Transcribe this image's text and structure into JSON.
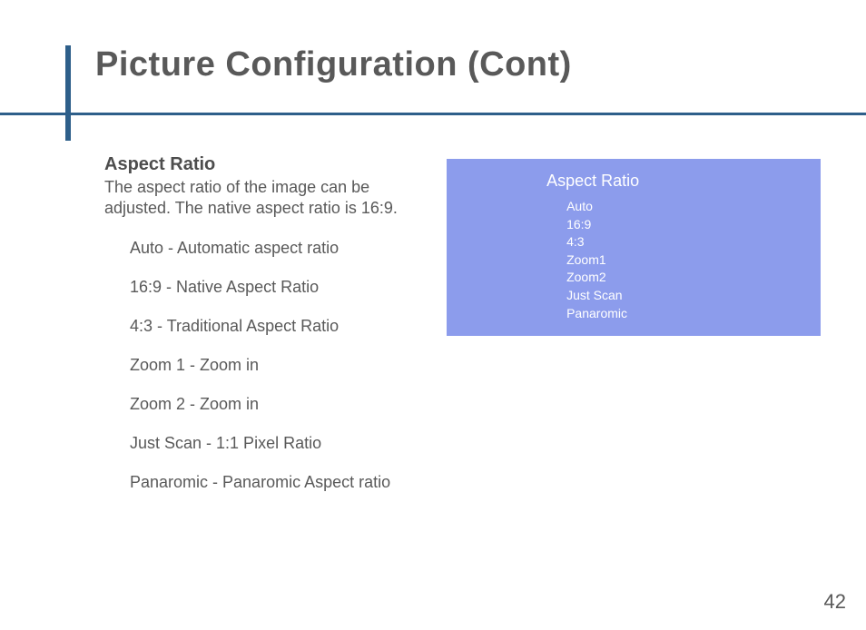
{
  "title": "Picture Configuration (Cont)",
  "section": {
    "heading": "Aspect Ratio",
    "description": "The aspect ratio of the image can be adjusted.  The native aspect ratio is 16:9.",
    "options": [
      "Auto - Automatic aspect ratio",
      "16:9 - Native Aspect Ratio",
      "4:3 - Traditional Aspect Ratio",
      "Zoom 1 - Zoom in",
      "Zoom 2 - Zoom in",
      "Just Scan - 1:1 Pixel Ratio",
      "Panaromic - Panaromic Aspect ratio"
    ]
  },
  "menu": {
    "title": "Aspect Ratio",
    "items": [
      "Auto",
      "16:9",
      "4:3",
      "Zoom1",
      "Zoom2",
      "Just Scan",
      "Panaromic"
    ]
  },
  "pageNumber": "42"
}
